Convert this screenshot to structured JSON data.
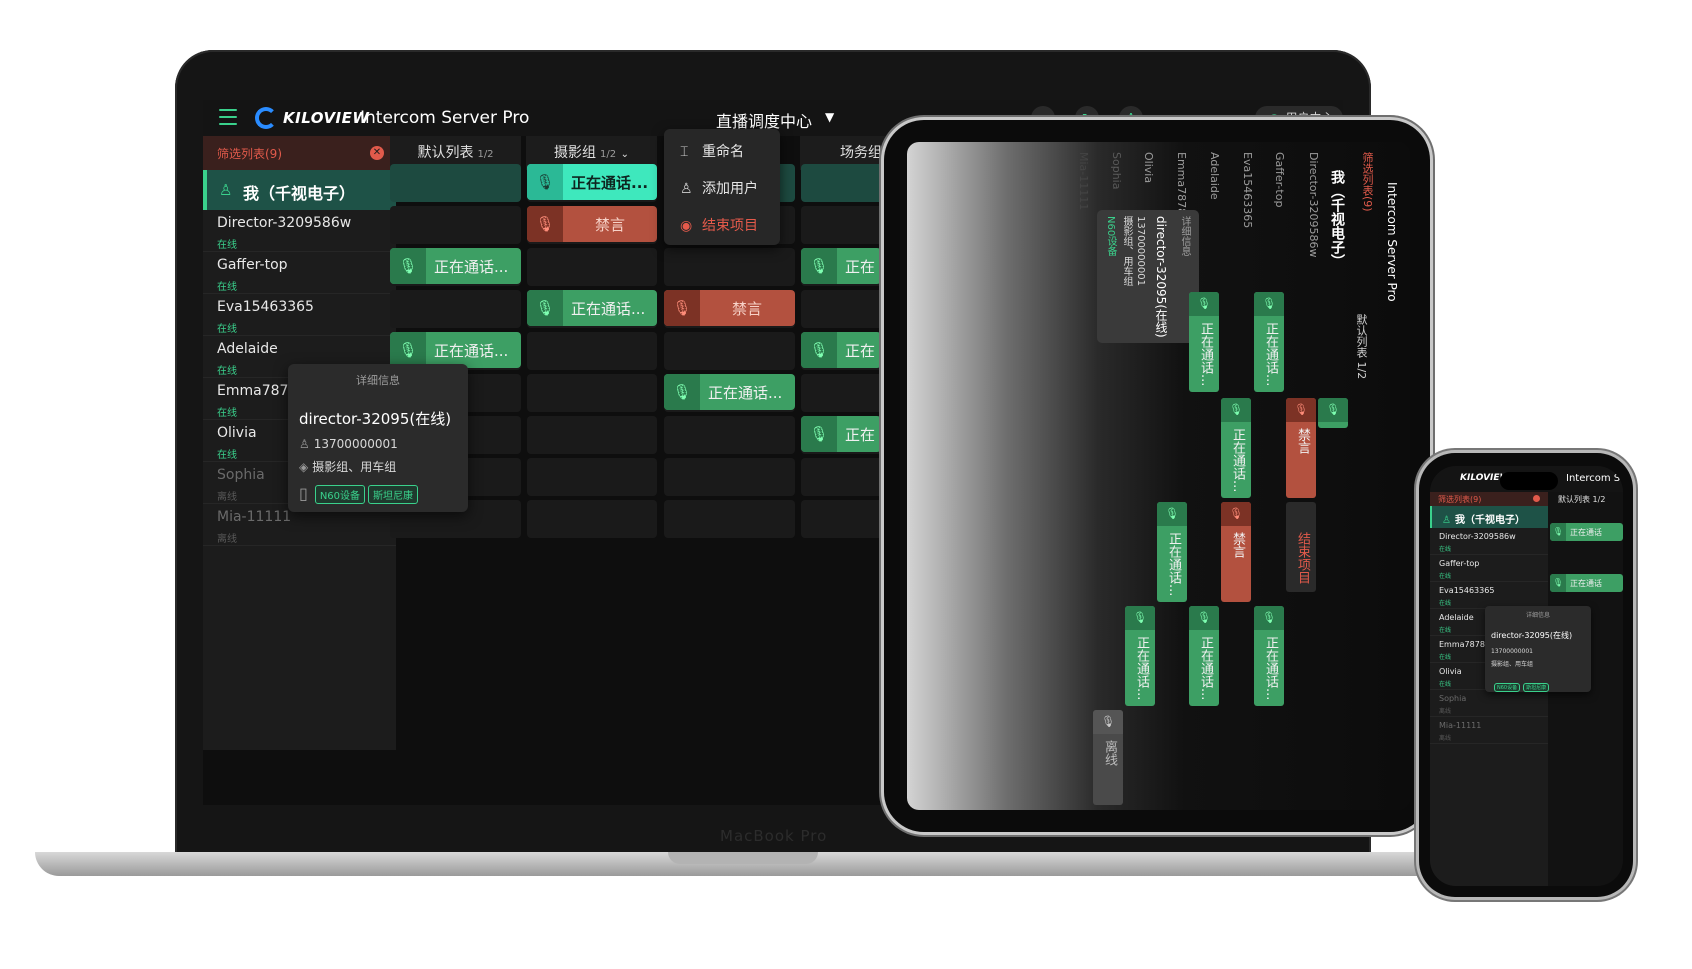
{
  "app": {
    "brand": "KILOVIEW",
    "title": "Intercom Server Pro",
    "center_title": "直播调度中心",
    "user_center": "用户中心",
    "laptop_label": "MacBook Pro"
  },
  "colors": {
    "accent": "#3ad18c",
    "danger": "#e15a4b",
    "brand_blue": "#2a8cff"
  },
  "toolbar": {
    "icons": [
      "search-icon",
      "refresh-icon",
      "font-icon",
      "user-icon"
    ],
    "font_label": "A"
  },
  "sidebar": {
    "filter_label": "筛选列表(9)",
    "me": "我（千视电子）",
    "users": [
      {
        "name": "Director-3209586w",
        "status": "在线"
      },
      {
        "name": "Gaffer-top",
        "status": "在线"
      },
      {
        "name": "Eva15463365",
        "status": "在线"
      },
      {
        "name": "Adelaide",
        "status": "在线"
      },
      {
        "name": "Emma7878",
        "status": "在线"
      },
      {
        "name": "Olivia",
        "status": "在线"
      },
      {
        "name": "Sophia",
        "status": "离线"
      },
      {
        "name": "Mia-11111",
        "status": "离线"
      }
    ]
  },
  "columns": [
    {
      "name": "默认列表",
      "page": "1/2"
    },
    {
      "name": "摄影组",
      "page": "1/2"
    },
    {
      "name": "场务组",
      "page": ""
    }
  ],
  "cells": {
    "talking": "正在通话...",
    "muted": "禁言",
    "talking_short": "正在",
    "talking_phone": "正在通话",
    "offline": "离线"
  },
  "context_menu": {
    "rename": "重命名",
    "add_user": "添加用户",
    "end_project": "结束项目"
  },
  "detail": {
    "header": "详细信息",
    "name": "director-32095(在线)",
    "phone": "13700000001",
    "groups": "摄影组、用车组",
    "tags": [
      "N60设备",
      "斯坦尼康"
    ]
  },
  "tablet": {
    "default_list": "默认列表 1/2"
  }
}
